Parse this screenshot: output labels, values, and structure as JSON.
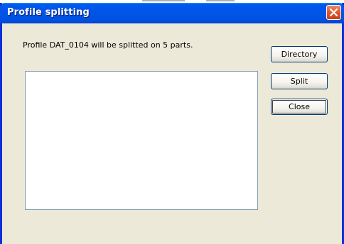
{
  "window": {
    "title": "Profile splitting"
  },
  "dialog": {
    "message": "Profile DAT_0104 will be splitted on 5 parts.",
    "directory_label": "Directory",
    "split_label": "Split",
    "close_label": "Close"
  },
  "icons": {
    "close": "close-icon"
  },
  "colors": {
    "titlebar": "#0054e3",
    "window_border": "#0831d9",
    "dialog_background": "#ece9d8",
    "close_button": "#e35a32",
    "list_border": "#7f9db9"
  }
}
